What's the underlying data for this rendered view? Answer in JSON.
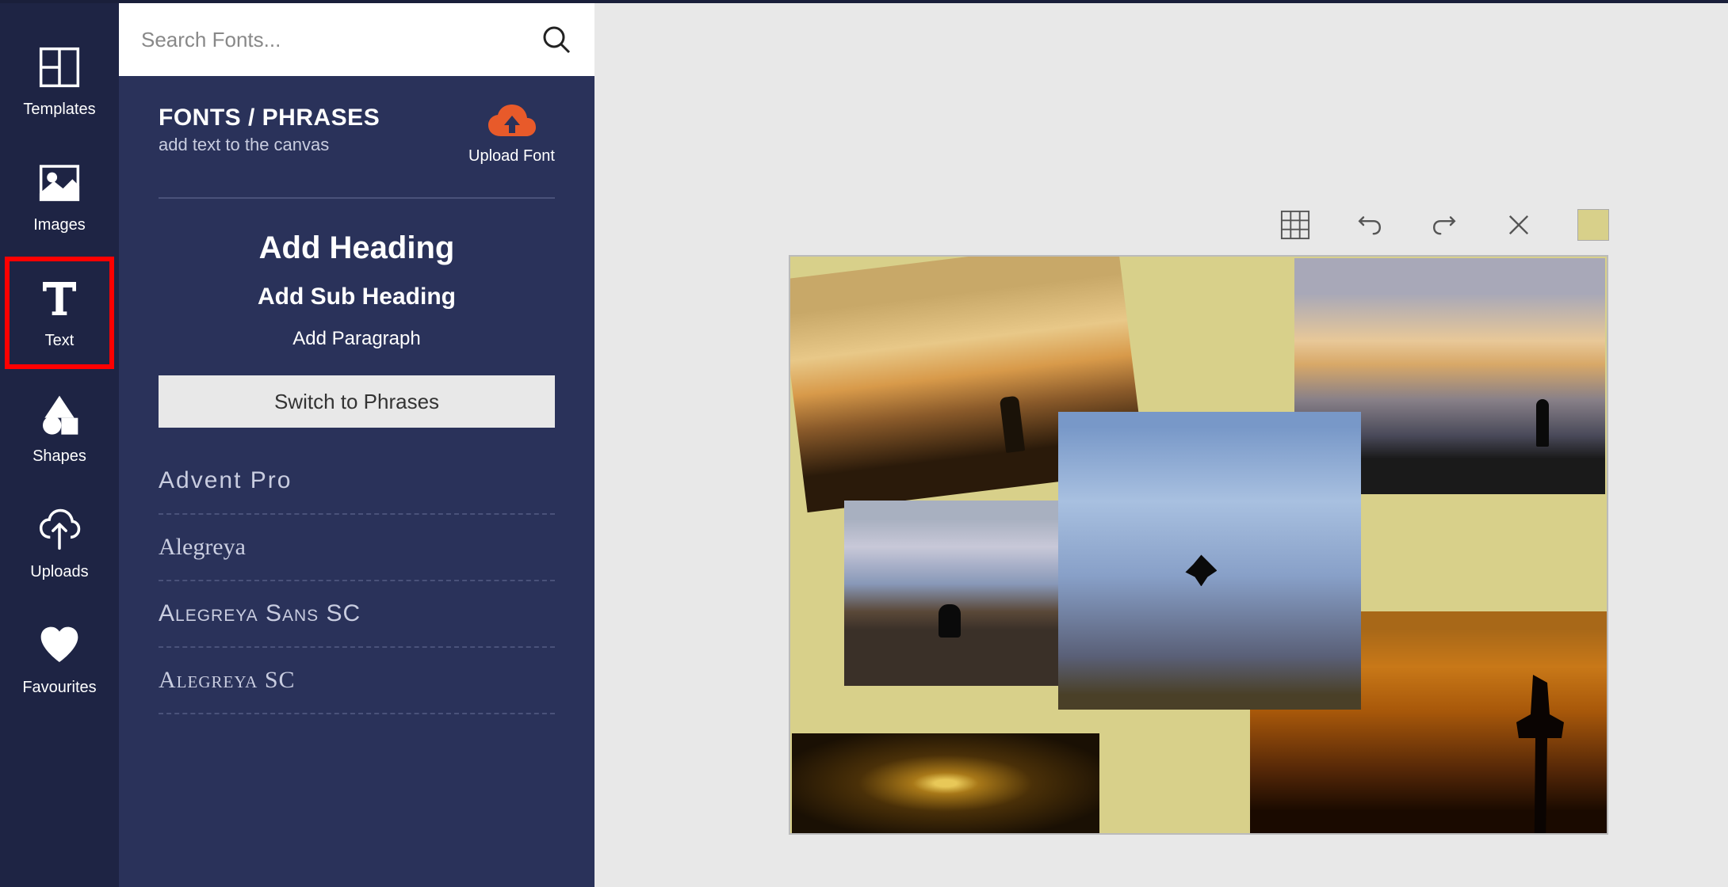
{
  "nav": {
    "items": [
      {
        "label": "Templates",
        "icon": "templates-icon"
      },
      {
        "label": "Images",
        "icon": "images-icon"
      },
      {
        "label": "Text",
        "icon": "text-icon",
        "active": true
      },
      {
        "label": "Shapes",
        "icon": "shapes-icon"
      },
      {
        "label": "Uploads",
        "icon": "uploads-icon"
      },
      {
        "label": "Favourites",
        "icon": "favourites-icon"
      }
    ]
  },
  "search": {
    "placeholder": "Search Fonts..."
  },
  "panel": {
    "title": "FONTS / PHRASES",
    "subtitle": "add text to the canvas",
    "upload_label": "Upload Font",
    "add_heading": "Add Heading",
    "add_subheading": "Add Sub Heading",
    "add_paragraph": "Add Paragraph",
    "switch_label": "Switch to Phrases"
  },
  "fonts": [
    "Advent Pro",
    "Alegreya",
    "Alegreya Sans SC",
    "Alegreya SC"
  ],
  "canvas": {
    "toolbar": {
      "grid": "grid-icon",
      "undo": "undo-icon",
      "redo": "redo-icon",
      "close": "close-icon",
      "swatch_color": "#d8d08a"
    },
    "background_color": "#d8d08a"
  }
}
